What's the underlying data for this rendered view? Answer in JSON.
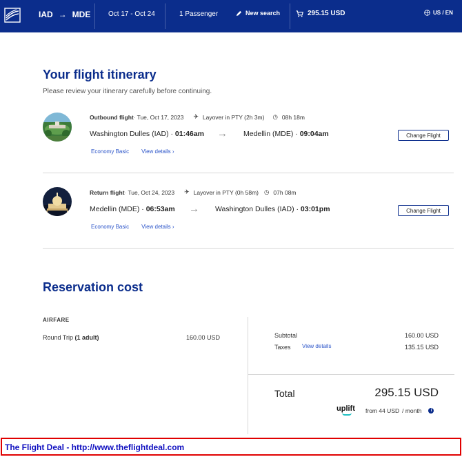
{
  "header": {
    "origin": "IAD",
    "destination": "MDE",
    "dates": "Oct 17 - Oct 24",
    "passengers": "1 Passenger",
    "new_search": "New search",
    "cart_total": "295.15 USD",
    "locale": "US / EN",
    "bg_color": "#0b2d8c"
  },
  "itinerary": {
    "title": "Your flight itinerary",
    "subtitle": "Please review your itinerary carefully before continuing.",
    "flights": [
      {
        "label": "Outbound flight",
        "date": "Tue, Oct 17, 2023",
        "layover": "Layover in PTY (2h 3m)",
        "duration": "08h 18m",
        "from_city": "Washington Dulles (IAD)",
        "from_time": "01:46am",
        "to_city": "Medellin (MDE)",
        "to_time": "09:04am",
        "fare": "Economy Basic",
        "details": "View details",
        "change": "Change Flight"
      },
      {
        "label": "Return flight",
        "date": "Tue, Oct 24, 2023",
        "layover": "Layover in PTY (0h 58m)",
        "duration": "07h 08m",
        "from_city": "Medellin (MDE)",
        "from_time": "06:53am",
        "to_city": "Washington Dulles (IAD)",
        "to_time": "03:01pm",
        "fare": "Economy Basic",
        "details": "View details",
        "change": "Change Flight"
      }
    ]
  },
  "cost": {
    "title": "Reservation cost",
    "airfare_heading": "AIRFARE",
    "trip_label": "Round Trip",
    "trip_pax": "(1 adult)",
    "trip_amount": "160.00 USD",
    "subtotal_label": "Subtotal",
    "subtotal_amount": "160.00 USD",
    "taxes_label": "Taxes",
    "taxes_link": "View details",
    "taxes_amount": "135.15 USD",
    "total_label": "Total",
    "total_amount": "295.15 USD",
    "uplift_brand": "uplift",
    "uplift_from": "from 44 USD",
    "uplift_per": "/ month"
  },
  "footer": {
    "text": "The Flight Deal - http://www.theflightdeal.com"
  }
}
